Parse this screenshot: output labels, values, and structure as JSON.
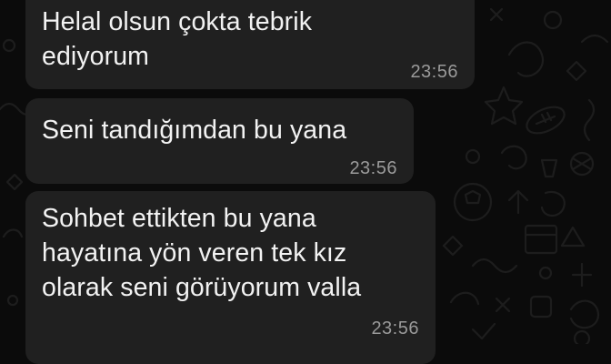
{
  "chat": {
    "messages": [
      {
        "lines": [
          "Helal olsun çokta tebrik",
          "ediyorum"
        ],
        "time": "23:56"
      },
      {
        "lines": [
          "Seni tandığımdan bu yana"
        ],
        "time": "23:56"
      },
      {
        "lines": [
          "Sohbet ettikten bu yana",
          "hayatına yön veren tek kız",
          "olarak seni görüyorum valla"
        ],
        "time": "23:56"
      }
    ]
  },
  "colors": {
    "background": "#0b0b0b",
    "bubble": "#202020",
    "text": "#f2f2f2",
    "timestamp": "#9a9a9a",
    "doodle": "#1c1c1c"
  }
}
